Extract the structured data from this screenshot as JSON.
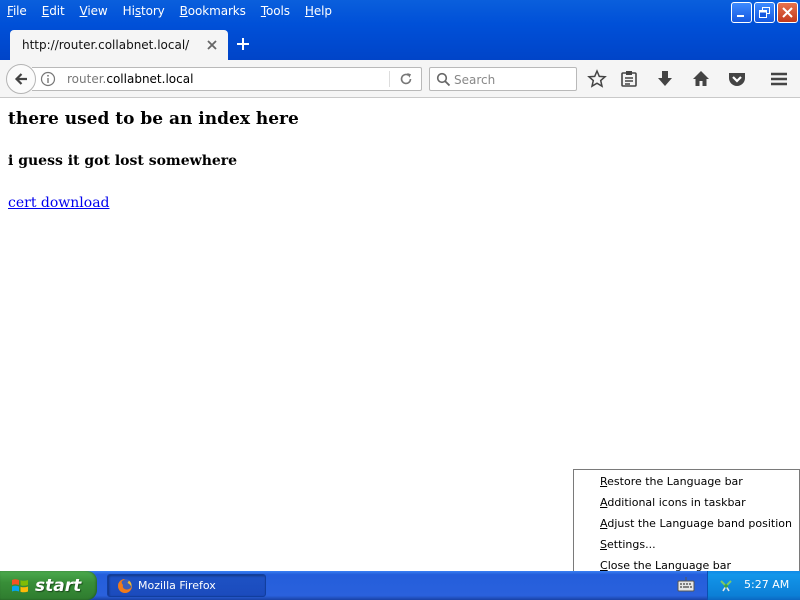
{
  "window": {
    "menu": [
      "File",
      "Edit",
      "View",
      "History",
      "Bookmarks",
      "Tools",
      "Help"
    ],
    "menu_underline": [
      "F",
      "E",
      "V",
      "s",
      "B",
      "T",
      "H"
    ]
  },
  "tab": {
    "title": "http://router.collabnet.local/"
  },
  "urlbar": {
    "host": "router.",
    "domain": "collabnet.local"
  },
  "search": {
    "placeholder": "Search"
  },
  "page": {
    "heading": "there used to be an index here",
    "subheading": "i guess it got lost somewhere",
    "link": "cert download"
  },
  "context_menu": {
    "items": [
      "Restore the Language bar",
      "Additional icons in taskbar",
      "Adjust the Language band position",
      "Settings...",
      "Close the Language bar"
    ],
    "mnemonics": [
      "R",
      "A",
      "A",
      "S",
      "C"
    ]
  },
  "taskbar": {
    "start_label": "start",
    "task_label": "Mozilla Firefox",
    "clock": "5:27 AM"
  },
  "colors": {
    "xp_blue": "#0050d8",
    "start_green": "#388e38",
    "link": "#0000ee"
  }
}
